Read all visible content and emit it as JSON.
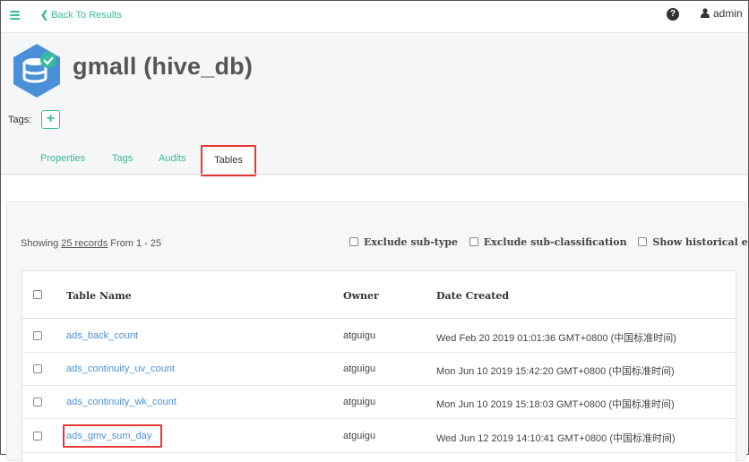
{
  "topbar": {
    "back_label": "Back To Results",
    "user_name": "admin"
  },
  "entity": {
    "title": "gmall (hive_db)",
    "tags_label": "Tags:",
    "tags_add": "+"
  },
  "tabs": [
    {
      "label": "Properties",
      "active": false
    },
    {
      "label": "Tags",
      "active": false
    },
    {
      "label": "Audits",
      "active": false
    },
    {
      "label": "Tables",
      "active": true
    }
  ],
  "results": {
    "showing_prefix": "Showing ",
    "showing_count": "25 records",
    "showing_suffix": " From 1 - 25"
  },
  "filters": [
    {
      "label": "Exclude sub-type"
    },
    {
      "label": "Exclude sub-classification"
    },
    {
      "label": "Show historical entities"
    }
  ],
  "table": {
    "columns": [
      "Table Name",
      "Owner",
      "Date Created"
    ],
    "rows": [
      {
        "name": "ads_back_count",
        "owner": "atguigu",
        "date": "Wed Feb 20 2019 01:01:36 GMT+0800 (中国标准时间)"
      },
      {
        "name": "ads_continuity_uv_count",
        "owner": "atguigu",
        "date": "Mon Jun 10 2019 15:42:20 GMT+0800 (中国标准时间)"
      },
      {
        "name": "ads_continuity_wk_count",
        "owner": "atguigu",
        "date": "Mon Jun 10 2019 15:18:03 GMT+0800 (中国标准时间)"
      },
      {
        "name": "ads_gmv_sum_day",
        "owner": "atguigu",
        "date": "Wed Jun 12 2019 14:10:41 GMT+0800 (中国标准时间)"
      }
    ]
  },
  "colors": {
    "accent": "#37bb9b",
    "link": "#4a90d9",
    "highlight": "#e53935"
  }
}
